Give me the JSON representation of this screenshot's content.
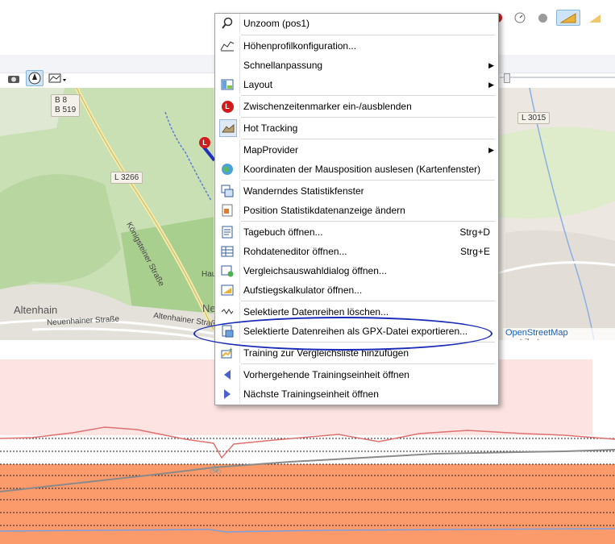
{
  "toolbar_top_right": {
    "icons": [
      "marker-icon",
      "gauge-icon",
      "dot-icon",
      "profile-icon",
      "profile-icon"
    ]
  },
  "map_toolbar": {
    "icons": [
      "camera-icon",
      "compass-icon",
      "map-style-icon"
    ]
  },
  "map": {
    "road_labels": [
      "B 8",
      "B 519",
      "L 3266",
      "L 3015"
    ],
    "places": [
      "Altenhain",
      "Ne"
    ],
    "streets": [
      "Königsteiner Straße",
      "Neuenhainer Straße",
      "Altenhainer Straße",
      "Hau"
    ],
    "attribution": {
      "link": "OpenStreetMap",
      "rest": "contributors"
    },
    "marker_letter": "L"
  },
  "menu": {
    "items": [
      {
        "label": "Unzoom (pos1)",
        "icon": "magnifier-icon"
      },
      {
        "label": "Höhenprofilkonfiguration...",
        "icon": "profile-config-icon"
      },
      {
        "label": "Schnellanpassung",
        "submenu": "▶"
      },
      {
        "label": "Layout",
        "icon": "layout-icon",
        "submenu": "▶"
      },
      {
        "label": "Zwischenzeitenmarker ein-/ausblenden",
        "icon": "marker-l-icon"
      },
      {
        "label": "Hot Tracking",
        "icon": "hot-tracking-icon"
      },
      {
        "label": "MapProvider",
        "submenu": "▶"
      },
      {
        "label": "Koordinaten der Mausposition auslesen (Kartenfenster)",
        "icon": "globe-icon"
      },
      {
        "label": "Wanderndes Statistikfenster",
        "icon": "stats-window-icon"
      },
      {
        "label": "Position Statistikdatenanzeige ändern",
        "icon": "position-icon"
      },
      {
        "label": "Tagebuch öffnen...",
        "icon": "diary-icon",
        "shortcut": "Strg+D"
      },
      {
        "label": "Rohdateneditor öffnen...",
        "icon": "table-icon",
        "shortcut": "Strg+E"
      },
      {
        "label": "Vergleichsauswahldialog öffnen...",
        "icon": "compare-icon"
      },
      {
        "label": "Aufstiegskalkulator öffnen...",
        "icon": "calculator-icon"
      },
      {
        "label": "Selektierte Datenreihen löschen...",
        "icon": "wave-icon"
      },
      {
        "label": "Selektierte Datenreihen als GPX-Datei exportieren...",
        "icon": "export-icon"
      },
      {
        "label": "Training zur Vergleichsliste hinzufügen",
        "icon": "add-compare-icon"
      },
      {
        "label": "Vorhergehende Trainingseinheit öffnen",
        "icon": "prev-icon"
      },
      {
        "label": "Nächste Trainingseinheit öffnen",
        "icon": "next-icon"
      }
    ]
  },
  "colors": {
    "chart_pink": "#fde4e2",
    "chart_orange": "#fb9a6a",
    "heart_line": "#e07070",
    "elevation_line": "#8a8a8a",
    "ellipse": "#1a2bb8"
  }
}
